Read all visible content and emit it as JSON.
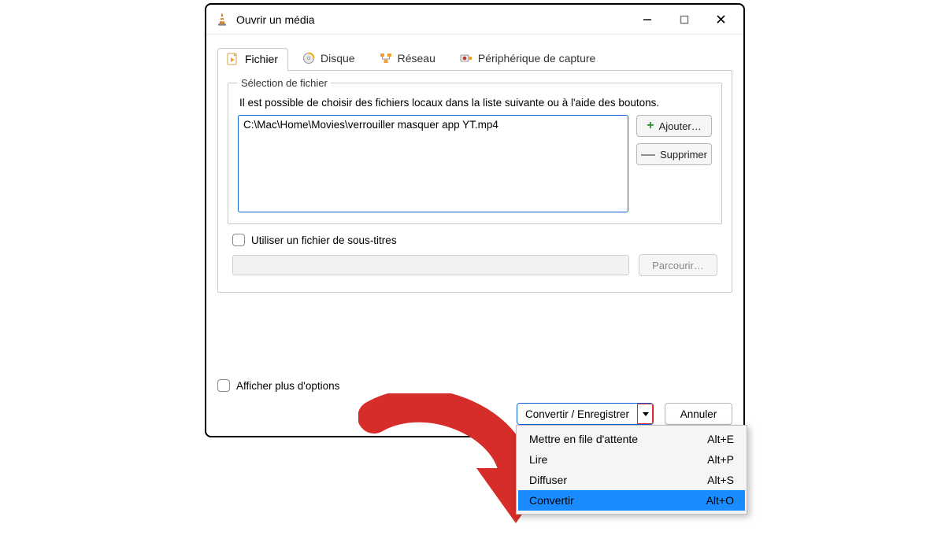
{
  "window": {
    "title": "Ouvrir un média"
  },
  "tabs": {
    "file": {
      "label": "Fichier"
    },
    "disc": {
      "label": "Disque"
    },
    "net": {
      "label": "Réseau"
    },
    "cap": {
      "label": "Périphérique de capture"
    }
  },
  "fileSelection": {
    "legend": "Sélection de fichier",
    "hint": "Il est possible de choisir des fichiers locaux dans la liste suivante ou à l'aide des boutons.",
    "files": [
      "C:\\Mac\\Home\\Movies\\verrouiller masquer app YT.mp4"
    ],
    "add_label": "Ajouter…",
    "remove_label": "Supprimer"
  },
  "subtitles": {
    "checkbox_label": "Utiliser un fichier de sous-titres",
    "browse_label": "Parcourir…"
  },
  "more_options_label": "Afficher plus d'options",
  "actions": {
    "convert_save_label": "Convertir / Enregistrer",
    "cancel_label": "Annuler"
  },
  "menu": {
    "items": [
      {
        "label": "Mettre en file d'attente",
        "shortcut": "Alt+E"
      },
      {
        "label": "Lire",
        "shortcut": "Alt+P"
      },
      {
        "label": "Diffuser",
        "shortcut": "Alt+S"
      },
      {
        "label": "Convertir",
        "shortcut": "Alt+O"
      }
    ],
    "selected_index": 3
  }
}
